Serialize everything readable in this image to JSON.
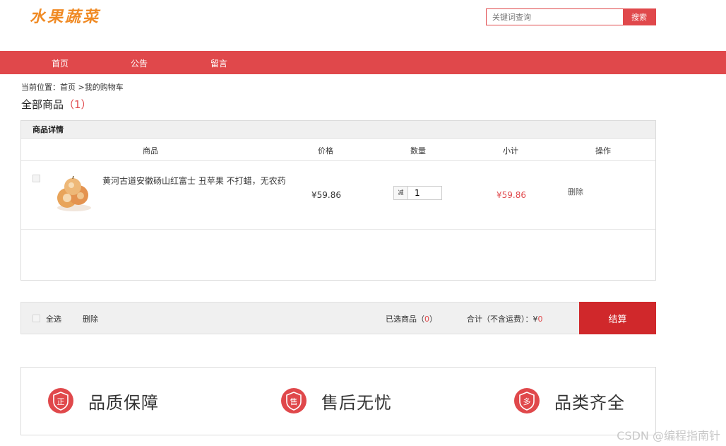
{
  "header": {
    "logo_text": "水果蔬菜",
    "search_placeholder": "关键词查询",
    "search_button": "搜索"
  },
  "nav": {
    "items": [
      {
        "label": "首页"
      },
      {
        "label": "公告"
      },
      {
        "label": "留言"
      }
    ]
  },
  "breadcrumb": "当前位置：首页 >我的购物车",
  "all_goods": {
    "label": "全部商品",
    "count": "（1）"
  },
  "table": {
    "title": "商品详情",
    "headers": {
      "product": "商品",
      "price": "价格",
      "quantity": "数量",
      "subtotal": "小计",
      "action": "操作"
    },
    "items": [
      {
        "name": "黄河古道安徽砀山红富士 丑苹果 不打蜡，无农药",
        "price": "¥59.86",
        "qty_minus": "减",
        "quantity": "1",
        "subtotal": "¥59.86",
        "delete_label": "删除"
      }
    ]
  },
  "footer": {
    "select_all": "全选",
    "delete": "删除",
    "selected_label": "已选商品（",
    "selected_count": "0",
    "selected_close": "）",
    "total_label": "合计（不含运费）：¥",
    "total_value": "0",
    "checkout": "结算"
  },
  "features": [
    {
      "icon": "quality-badge-icon",
      "glyph": "正",
      "label": "品质保障"
    },
    {
      "icon": "after-sales-badge-icon",
      "glyph": "售",
      "label": "售后无忧"
    },
    {
      "icon": "variety-badge-icon",
      "glyph": "多",
      "label": "品类齐全"
    }
  ],
  "watermark": "CSDN @编程指南针",
  "colors": {
    "brand_red": "#e0484b",
    "checkout_red": "#d0282b",
    "logo_orange": "#f08a24"
  }
}
